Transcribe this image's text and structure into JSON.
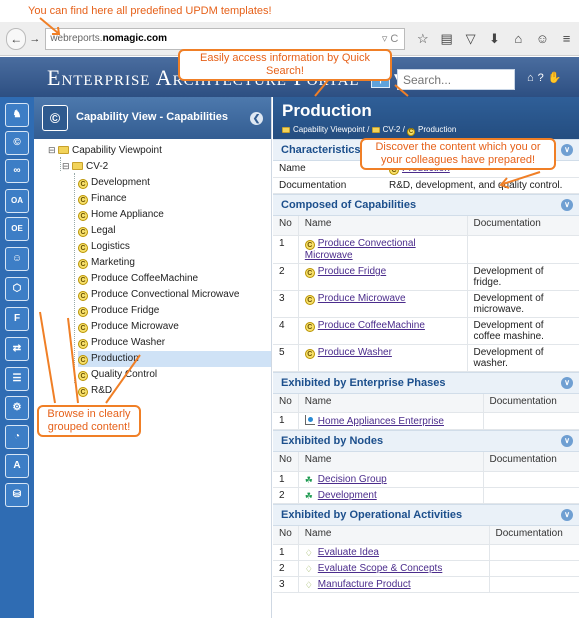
{
  "callouts": {
    "top_note": "You can find here all predefined UPDM templates!",
    "search_note": "Easily access information by Quick Search!",
    "content_note": "Discover the content which you or your colleagues have prepared!",
    "browse_note": "Browse in clearly grouped content!"
  },
  "browser": {
    "back_glyph": "←",
    "forward_glyph": "→",
    "url_prefix": "webreports.",
    "url_host": "nomagic.com",
    "url_icons": "▿ C",
    "toolbar_icons": [
      "☆",
      "▤",
      "▽",
      "⬇",
      "⌂",
      "☺",
      "≡"
    ]
  },
  "portal": {
    "title": "Enterprise Architecture Portal",
    "search_placeholder": "Search...",
    "search_glyph": "⚲",
    "home_glyph": "⌂",
    "help_glyph": "?",
    "user_glyph": "✋"
  },
  "iconbar": {
    "items": [
      "♞",
      "©",
      "∞",
      "OA",
      "OE",
      "☺",
      "⬡",
      "F",
      "⇄",
      "☰",
      "⚙",
      "◔",
      "A",
      "⛁"
    ]
  },
  "tree": {
    "header_icon": "©",
    "title": "Capability View - Capabilities",
    "collapse_glyph": "❮",
    "root": "Capability Viewpoint",
    "folder": "CV-2",
    "items": [
      "Development",
      "Finance",
      "Home Appliance",
      "Legal",
      "Logistics",
      "Marketing",
      "Produce CoffeeMachine",
      "Produce Convectional Microwave",
      "Produce Fridge",
      "Produce Microwave",
      "Produce Washer",
      "Production",
      "Quality Control",
      "R&D"
    ],
    "selected": "Production"
  },
  "main": {
    "title": "Production",
    "breadcrumb": [
      "Capability Viewpoint",
      "CV-2",
      "Production"
    ],
    "characteristics": {
      "title": "Characteristics",
      "rows": [
        {
          "label": "Name",
          "value": "Production"
        },
        {
          "label": "Documentation",
          "value": "R&D, development, and quality control."
        }
      ]
    },
    "col_no": "No",
    "col_name": "Name",
    "col_doc": "Documentation",
    "composed": {
      "title": "Composed of Capabilities",
      "rows": [
        {
          "no": "1",
          "name": "Produce Convectional Microwave",
          "doc": ""
        },
        {
          "no": "2",
          "name": "Produce Fridge",
          "doc": "Development of fridge."
        },
        {
          "no": "3",
          "name": "Produce Microwave",
          "doc": "Development of microwave."
        },
        {
          "no": "4",
          "name": "Produce CoffeeMachine",
          "doc": "Development of coffee mashine."
        },
        {
          "no": "5",
          "name": "Produce Washer",
          "doc": "Development of washer."
        }
      ]
    },
    "phases": {
      "title": "Exhibited by Enterprise Phases",
      "rows": [
        {
          "no": "1",
          "name": "Home Appliances Enterprise",
          "doc": ""
        }
      ]
    },
    "nodes": {
      "title": "Exhibited by Nodes",
      "rows": [
        {
          "no": "1",
          "name": "Decision Group",
          "doc": ""
        },
        {
          "no": "2",
          "name": "Development",
          "doc": ""
        }
      ]
    },
    "activities": {
      "title": "Exhibited by Operational Activities",
      "rows": [
        {
          "no": "1",
          "name": "Evaluate Idea",
          "doc": ""
        },
        {
          "no": "2",
          "name": "Evaluate Scope & Concepts",
          "doc": ""
        },
        {
          "no": "3",
          "name": "Manufacture Product",
          "doc": ""
        }
      ]
    },
    "toggle_glyph": "∨",
    "cap_glyph": "C",
    "node_glyph": "☘",
    "activity_glyph": "♢"
  },
  "colors": {
    "accent": "#f07f26",
    "header_blue": "#2d4f82",
    "iconbar_blue": "#2f6cb3",
    "link": "#4b2c8c"
  }
}
